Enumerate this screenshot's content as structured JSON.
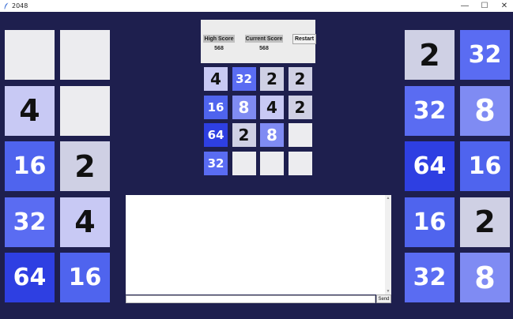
{
  "window": {
    "title": "2048",
    "minimize_glyph": "—",
    "maximize_glyph": "☐",
    "close_glyph": "✕"
  },
  "scores": {
    "high_score_label": "High Score",
    "high_score_value": "568",
    "current_score_label": "Current Score",
    "current_score_value": "568",
    "restart_label": "Restart"
  },
  "chat": {
    "send_label": "Send",
    "input_value": ""
  },
  "left_board": [
    [
      "",
      ""
    ],
    [
      "4",
      ""
    ],
    [
      "16",
      "2"
    ],
    [
      "32",
      "4"
    ],
    [
      "64",
      "16"
    ]
  ],
  "center_board": [
    [
      "4",
      "32",
      "2",
      "2"
    ],
    [
      "16",
      "8",
      "4",
      "2"
    ],
    [
      "64",
      "2",
      "8",
      ""
    ],
    [
      "32",
      "",
      "",
      ""
    ]
  ],
  "right_board": [
    [
      "2",
      "32"
    ],
    [
      "32",
      "8"
    ],
    [
      "64",
      "16"
    ],
    [
      "16",
      "2"
    ],
    [
      "32",
      "8"
    ]
  ],
  "tile_colors": {
    "empty": "#ececef",
    "2": "#cfd0e4",
    "4": "#c8c9f4",
    "8": "#7f8bf3",
    "16": "#4f64ee",
    "32": "#5a6cf2",
    "64": "#2e3fe2"
  },
  "tile_text_colors": {
    "2": "#111111",
    "4": "#111111",
    "8": "#ffffff",
    "16": "#ffffff",
    "32": "#ffffff",
    "64": "#ffffff"
  },
  "background_color": "#1e1f4e"
}
